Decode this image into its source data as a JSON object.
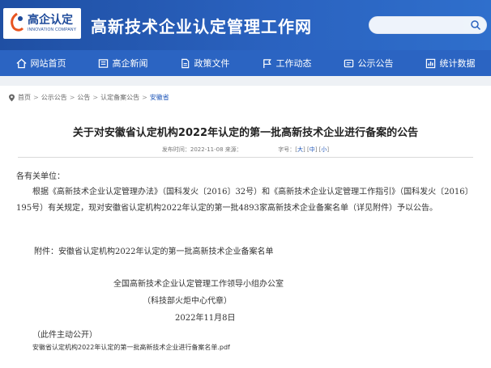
{
  "header": {
    "logo_cn": "高企认定",
    "logo_en": "INNOVATION COMPANY",
    "site_title": "高新技术企业认定管理工作网",
    "search_placeholder": ""
  },
  "nav": [
    {
      "label": "网站首页",
      "icon": "home-icon"
    },
    {
      "label": "高企新闻",
      "icon": "news-icon"
    },
    {
      "label": "政策文件",
      "icon": "document-icon"
    },
    {
      "label": "工作动态",
      "icon": "flag-icon"
    },
    {
      "label": "公示公告",
      "icon": "announcement-icon"
    },
    {
      "label": "统计数据",
      "icon": "chart-icon"
    }
  ],
  "breadcrumb": [
    "首页",
    "公示公告",
    "公告",
    "认定备案公告",
    "安徽省"
  ],
  "article": {
    "title": "关于对安徽省认定机构2022年认定的第一批高新技术企业进行备案的公告",
    "publish_label": "发布时间：",
    "publish_date": "2022-11-08 来源：",
    "font_size_label": "字号：",
    "font_sizes": [
      "大",
      "中",
      "小"
    ],
    "salutation": "各有关单位：",
    "main_paragraph": "根据《高新技术企业认定管理办法》（国科发火〔2016〕32号）和《高新技术企业认定管理工作指引》（国科发火〔2016〕195号）有关规定，现对安徽省认定机构2022年认定的第一批4893家高新技术企业备案名单（详见附件）予以公告。",
    "attachment_line": "附件：安徽省认定机构2022年认定的第一批高新技术企业备案名单",
    "signature_org": "全国高新技术企业认定管理工作领导小组办公室",
    "signature_sub": "（科技部火炬中心代章）",
    "signature_date": "2022年11月8日",
    "public_note": "（此件主动公开）",
    "file_link": "安徽省认定机构2022年认定的第一批高新技术企业进行备案名单.pdf"
  },
  "colors": {
    "header_bg": "#2a62bf",
    "nav_bg": "#2b64c2",
    "link": "#1e56b8"
  }
}
